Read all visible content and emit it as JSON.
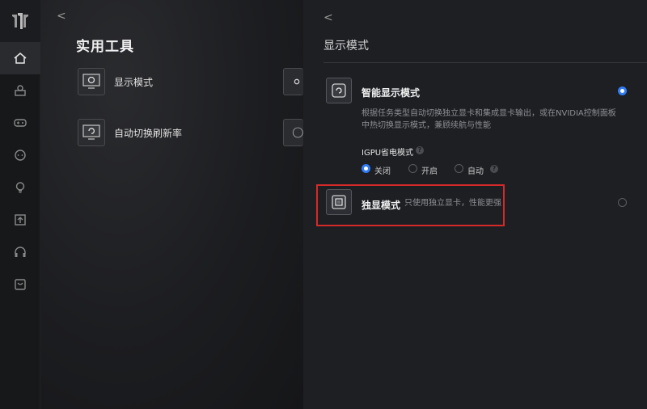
{
  "sidebar": {
    "items": [
      {
        "icon": "home-icon"
      },
      {
        "icon": "device-icon"
      },
      {
        "icon": "gamepad-icon"
      },
      {
        "icon": "chat-icon"
      },
      {
        "icon": "bulb-icon"
      },
      {
        "icon": "upload-icon"
      },
      {
        "icon": "headset-icon"
      },
      {
        "icon": "store-icon"
      }
    ]
  },
  "tools": {
    "back": "<",
    "title": "实用工具",
    "items": [
      {
        "label": "显示模式",
        "icon": "monitor-settings-icon"
      },
      {
        "label": "自动切换刷新率",
        "icon": "monitor-refresh-icon"
      }
    ]
  },
  "display": {
    "back": "<",
    "title": "显示模式",
    "smart": {
      "title": "智能显示模式",
      "desc_line1": "根据任务类型自动切换独立显卡和集成显卡输出，或在NVIDIA控制面板",
      "desc_line2": "中热切换显示模式，兼顾续航与性能",
      "selected": true
    },
    "igpu": {
      "title": "IGPU省电模式",
      "options": [
        "关闭",
        "开启",
        "自动"
      ],
      "selected": "关闭"
    },
    "discrete": {
      "title": "独显模式",
      "desc": "只使用独立显卡，性能更强",
      "selected": false
    },
    "accent": "#2f7cf6",
    "highlight_color": "#d42a2a"
  }
}
